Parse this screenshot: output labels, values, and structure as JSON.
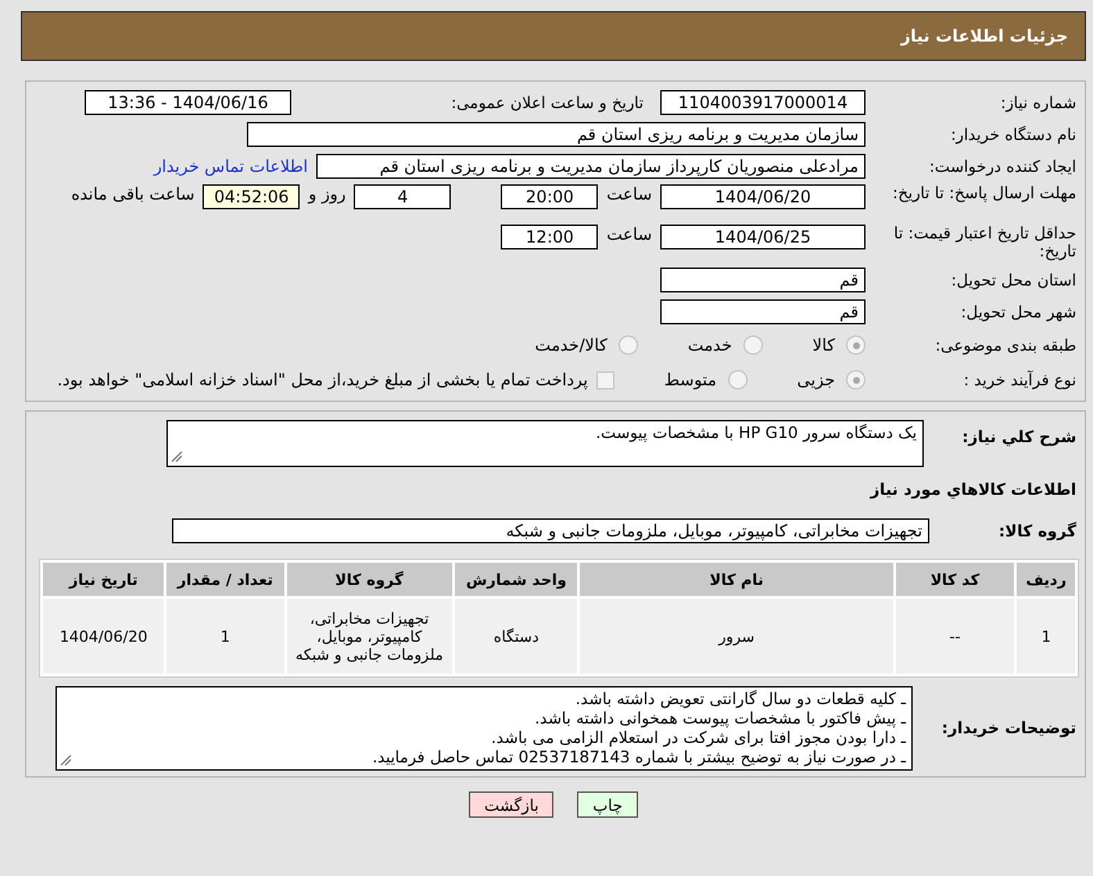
{
  "header": {
    "title": "جزئیات اطلاعات نیاز"
  },
  "need_number": {
    "label": "شماره نیاز:",
    "value": "1104003917000014"
  },
  "announce": {
    "label": "تاریخ و ساعت اعلان عمومی:",
    "value": "1404/06/16 - 13:36"
  },
  "buyer": {
    "label": "نام دستگاه خریدار:",
    "value": "سازمان مدیریت و برنامه ریزی استان قم"
  },
  "creator": {
    "label": "ایجاد کننده درخواست:",
    "value": "مرادعلی منصوریان کارپرداز سازمان مدیریت و برنامه ریزی استان قم",
    "link": "اطلاعات تماس خریدار"
  },
  "deadline": {
    "label": "مهلت ارسال پاسخ: تا تاریخ:",
    "date": "1404/06/20",
    "time_label": "ساعت",
    "time": "20:00",
    "days": "4",
    "days_label": "روز و",
    "remaining": "04:52:06",
    "remaining_label": "ساعت باقی مانده"
  },
  "validity": {
    "label": "حداقل تاریخ اعتبار قیمت: تا تاریخ:",
    "date": "1404/06/25",
    "time_label": "ساعت",
    "time": "12:00"
  },
  "province": {
    "label": "استان محل تحویل:",
    "value": "قم"
  },
  "city": {
    "label": "شهر محل تحویل:",
    "value": "قم"
  },
  "category": {
    "label": "طبقه بندی موضوعی:",
    "options": [
      {
        "label": "کالا",
        "selected": true
      },
      {
        "label": "خدمت",
        "selected": false
      },
      {
        "label": "کالا/خدمت",
        "selected": false
      }
    ]
  },
  "process": {
    "label": "نوع فرآیند خرید :",
    "options": [
      {
        "label": "جزیی",
        "selected": true
      },
      {
        "label": "متوسط",
        "selected": false
      }
    ],
    "payment": {
      "label": "پرداخت تمام یا بخشی از مبلغ خرید،از محل \"اسناد خزانه اسلامی\" خواهد بود.",
      "checked": false
    }
  },
  "description": {
    "label": "شرح کلي نیاز:",
    "value": "یک دستگاه سرور HP G10 با مشخصات پیوست."
  },
  "goods_title": "اطلاعات کالاهاي مورد نیاز",
  "goods_group": {
    "label": "گروه کالا:",
    "value": "تجهیزات مخابراتی، کامپیوتر، موبایل، ملزومات جانبی و شبکه"
  },
  "table": {
    "columns": [
      "ردیف",
      "کد کالا",
      "نام کالا",
      "واحد شمارش",
      "گروه کالا",
      "تعداد / مقدار",
      "تاریخ نیاز"
    ],
    "rows": [
      [
        "1",
        "--",
        "سرور",
        "دستگاه",
        "تجهیزات مخابراتی، کامپیوتر، موبایل، ملزومات جانبی و شبکه",
        "1",
        "1404/06/20"
      ]
    ]
  },
  "buyer_notes": {
    "label": "توضیحات خریدار:",
    "lines": [
      "ـ کلیه قطعات دو سال گارانتی تعویض داشته باشد.",
      "ـ پیش فاکتور با مشخصات پیوست همخوانی داشته باشد.",
      "ـ دارا بودن مجوز افتا برای شرکت در استعلام الزامی می باشد.",
      "ـ در صورت نیاز به توضیح بیشتر با شماره 02537187143 تماس حاصل فرمایید."
    ]
  },
  "buttons": [
    {
      "label": "چاپ",
      "kind": "print"
    },
    {
      "label": "بازگشت",
      "kind": "back"
    }
  ]
}
